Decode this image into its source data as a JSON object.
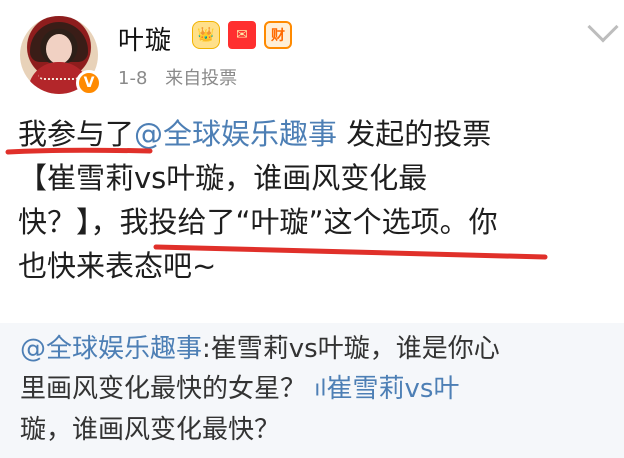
{
  "header": {
    "username": "叶璇",
    "timestamp": "1-8",
    "source": "来自投票",
    "badges": {
      "crown": "👑",
      "redpacket": "✉",
      "cai": "财"
    },
    "verified_mark": "V"
  },
  "post": {
    "line1_prefix": "我参与了",
    "line1_mention": "@全球娱乐趣事",
    "line1_suffix": " 发起的投票",
    "line2": "【崔雪莉vs叶璇，谁画风变化最",
    "line3_prefix": "快？】，",
    "line3_highlight": "我投给了“叶璇”这个选项。你",
    "line4": "也快来表态吧~"
  },
  "repost": {
    "mention": "@全球娱乐趣事",
    "line1_rest": ":崔雪莉vs叶璇，谁是你心",
    "line2_prefix": "里画风变化最快的女星？",
    "poll_icon": "ıl",
    "line2_poll": "崔雪莉vs叶",
    "line3": "璇，谁画风变化最快？"
  },
  "colors": {
    "accent": "#4d7fb5",
    "underline": "#e0302a",
    "meta": "#8a8a8a",
    "repost_bg": "#f5f7fa"
  }
}
